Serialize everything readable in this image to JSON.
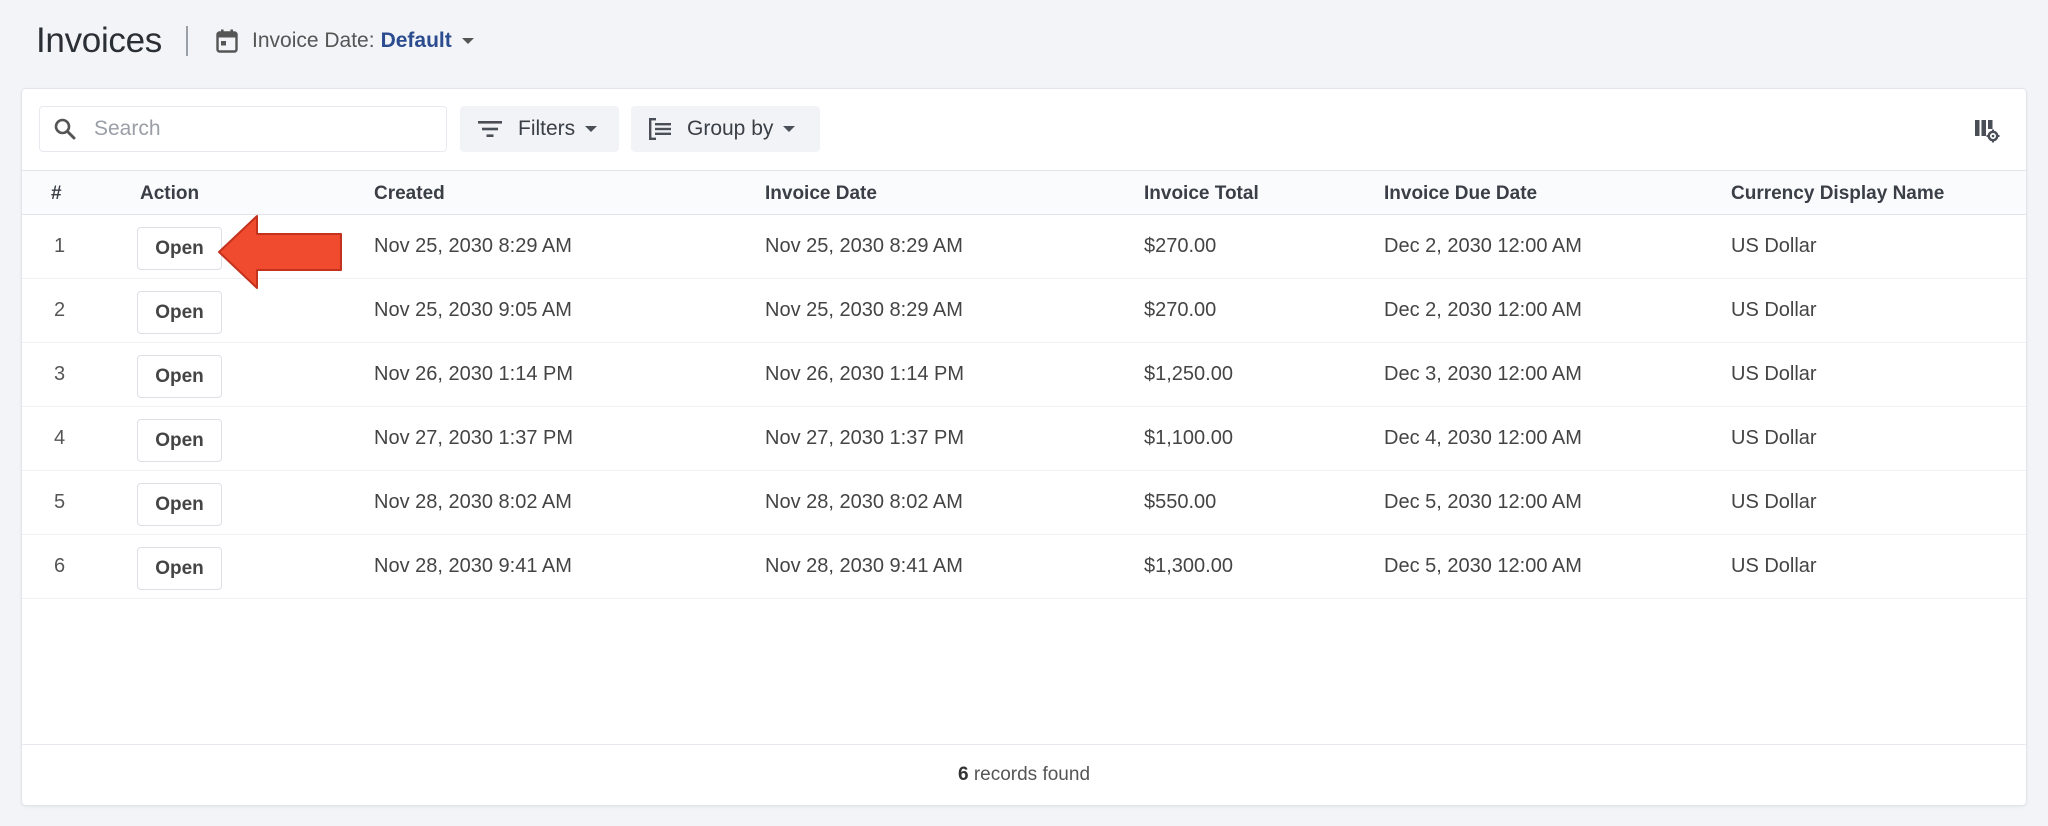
{
  "header": {
    "title": "Invoices",
    "date_filter_label": "Invoice Date:",
    "date_filter_value": "Default"
  },
  "toolbar": {
    "search_placeholder": "Search",
    "filters_label": "Filters",
    "groupby_label": "Group by"
  },
  "table": {
    "columns": [
      "#",
      "Action",
      "Created",
      "Invoice Date",
      "Invoice Total",
      "Invoice Due Date",
      "Currency Display Name"
    ],
    "rows": [
      {
        "num": "1",
        "action": "Open",
        "created": "Nov 25, 2030 8:29 AM",
        "invoice_date": "Nov 25, 2030 8:29 AM",
        "total": "$270.00",
        "due": "Dec 2, 2030 12:00 AM",
        "currency": "US Dollar"
      },
      {
        "num": "2",
        "action": "Open",
        "created": "Nov 25, 2030 9:05 AM",
        "invoice_date": "Nov 25, 2030 8:29 AM",
        "total": "$270.00",
        "due": "Dec 2, 2030 12:00 AM",
        "currency": "US Dollar"
      },
      {
        "num": "3",
        "action": "Open",
        "created": "Nov 26, 2030 1:14 PM",
        "invoice_date": "Nov 26, 2030 1:14 PM",
        "total": "$1,250.00",
        "due": "Dec 3, 2030 12:00 AM",
        "currency": "US Dollar"
      },
      {
        "num": "4",
        "action": "Open",
        "created": "Nov 27, 2030 1:37 PM",
        "invoice_date": "Nov 27, 2030 1:37 PM",
        "total": "$1,100.00",
        "due": "Dec 4, 2030 12:00 AM",
        "currency": "US Dollar"
      },
      {
        "num": "5",
        "action": "Open",
        "created": "Nov 28, 2030 8:02 AM",
        "invoice_date": "Nov 28, 2030 8:02 AM",
        "total": "$550.00",
        "due": "Dec 5, 2030 12:00 AM",
        "currency": "US Dollar"
      },
      {
        "num": "6",
        "action": "Open",
        "created": "Nov 28, 2030 9:41 AM",
        "invoice_date": "Nov 28, 2030 9:41 AM",
        "total": "$1,300.00",
        "due": "Dec 5, 2030 12:00 AM",
        "currency": "US Dollar"
      }
    ]
  },
  "footer": {
    "count": "6",
    "label": "records found"
  },
  "colors": {
    "accent_link": "#2b4d8f",
    "annotation_arrow": "#f04a2f"
  },
  "icons": [
    "calendar-icon",
    "search-icon",
    "filter-icon",
    "group-by-icon",
    "column-settings-icon",
    "pointer-arrow-annotation"
  ]
}
